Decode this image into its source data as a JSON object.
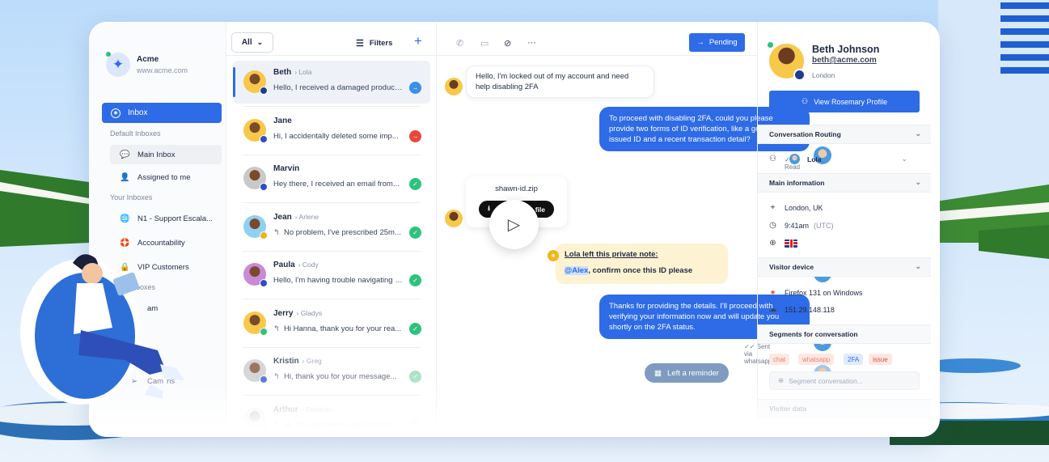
{
  "colors": {
    "accent": "#2e6be6",
    "success": "#2ec27e",
    "danger": "#e8473b",
    "note": "#fdf3d3"
  },
  "sidebar": {
    "brand_name": "Acme",
    "brand_url": "www.acme.com",
    "inbox_label": "Inbox",
    "default_inboxes_label": "Default Inboxes",
    "default_items": [
      {
        "label": "Main Inbox",
        "icon": "chat-bubble-icon"
      },
      {
        "label": "Assigned to me",
        "icon": "person-icon"
      }
    ],
    "your_inboxes_label": "Your Inboxes",
    "your_items": [
      {
        "label": "N1 - Support Escala...",
        "icon": "globe-icon"
      },
      {
        "label": "Accountability",
        "icon": "lifebuoy-icon"
      },
      {
        "label": "VIP Customers",
        "icon": "lock-icon"
      }
    ],
    "partial_labels": [
      "boxes",
      "am",
      "Cam",
      "ns"
    ]
  },
  "list": {
    "filter_value": "All",
    "filters_label": "Filters",
    "conversations": [
      {
        "name": "Beth",
        "assignee": "Lola",
        "message": "Hello, I received a damaged product...",
        "status": "arrow",
        "status_color": "#3b8fe8",
        "reply": false
      },
      {
        "name": "Jane",
        "assignee": "",
        "message": "Hi, I accidentally deleted some imp...",
        "status": "arrow",
        "status_color": "#e8473b",
        "reply": false
      },
      {
        "name": "Marvin",
        "assignee": "",
        "message": "Hey there, I received an email from...",
        "status": "check",
        "status_color": "#2ec27e",
        "reply": false
      },
      {
        "name": "Jean",
        "assignee": "Arlene",
        "message": "No problem, I've prescribed 25m...",
        "status": "check",
        "status_color": "#2ec27e",
        "reply": true
      },
      {
        "name": "Paula",
        "assignee": "Cody",
        "message": "Hello, I'm having trouble navigating t...",
        "status": "check",
        "status_color": "#2ec27e",
        "reply": false
      },
      {
        "name": "Jerry",
        "assignee": "Gladys",
        "message": "Hi Hanna, thank you for your rea...",
        "status": "check",
        "status_color": "#2ec27e",
        "reply": true
      },
      {
        "name": "Kristin",
        "assignee": "Greg",
        "message": "Hi, thank you for your message...",
        "status": "check",
        "status_color": "#8fdcb5",
        "reply": true
      },
      {
        "name": "Arthur",
        "assignee": "Eduardo",
        "message": "Hi, The symptoms you describe a...",
        "status": "check",
        "status_color": "#cfeedd",
        "reply": true
      }
    ]
  },
  "chat": {
    "pending_label": "Pending",
    "messages": [
      "Hello, I'm locked out of my account and need help disabling 2FA",
      "To proceed with disabling 2FA, could you please provide two forms of ID verification, like a government-issued ID and a recent transaction detail?",
      "Thanks for providing the details. I'll proceed with verifying your information now and will update you shortly on the 2FA status."
    ],
    "read_label": "Read",
    "file_name": "shawn-id.zip",
    "download_label": "file",
    "note_title": "Lola left this private note:",
    "note_mention": "@Alex",
    "note_body": ", confirm once this ID please",
    "sent_label": "Sent via whatsapp",
    "reminder_label": "Left a reminder"
  },
  "profile": {
    "name": "Beth Johnson",
    "email": "beth@acme.com",
    "location": "London",
    "view_button": "View Rosemary Profile",
    "routing_title": "Conversation Routing",
    "routing_assignee": "Lola",
    "main_info_title": "Main information",
    "city": "London, UK",
    "time": "9:41am",
    "timezone": "(UTC)",
    "device_title": "Visitor device",
    "browser": "Firefox 131 on Windows",
    "ip": "151.29.148.118",
    "segments_title": "Segments for conversation",
    "tags": [
      {
        "label": "chat",
        "bg": "#fde8e3",
        "fg": "#e8836b"
      },
      {
        "label": "whatsapp",
        "bg": "#fde8e3",
        "fg": "#e8836b"
      },
      {
        "label": "2FA",
        "bg": "#dfeafd",
        "fg": "#2e6be6"
      },
      {
        "label": "issue",
        "bg": "#fde8e3",
        "fg": "#e8473b"
      }
    ],
    "segment_placeholder": "Segment conversation...",
    "visitor_data_title": "Visitor data"
  }
}
